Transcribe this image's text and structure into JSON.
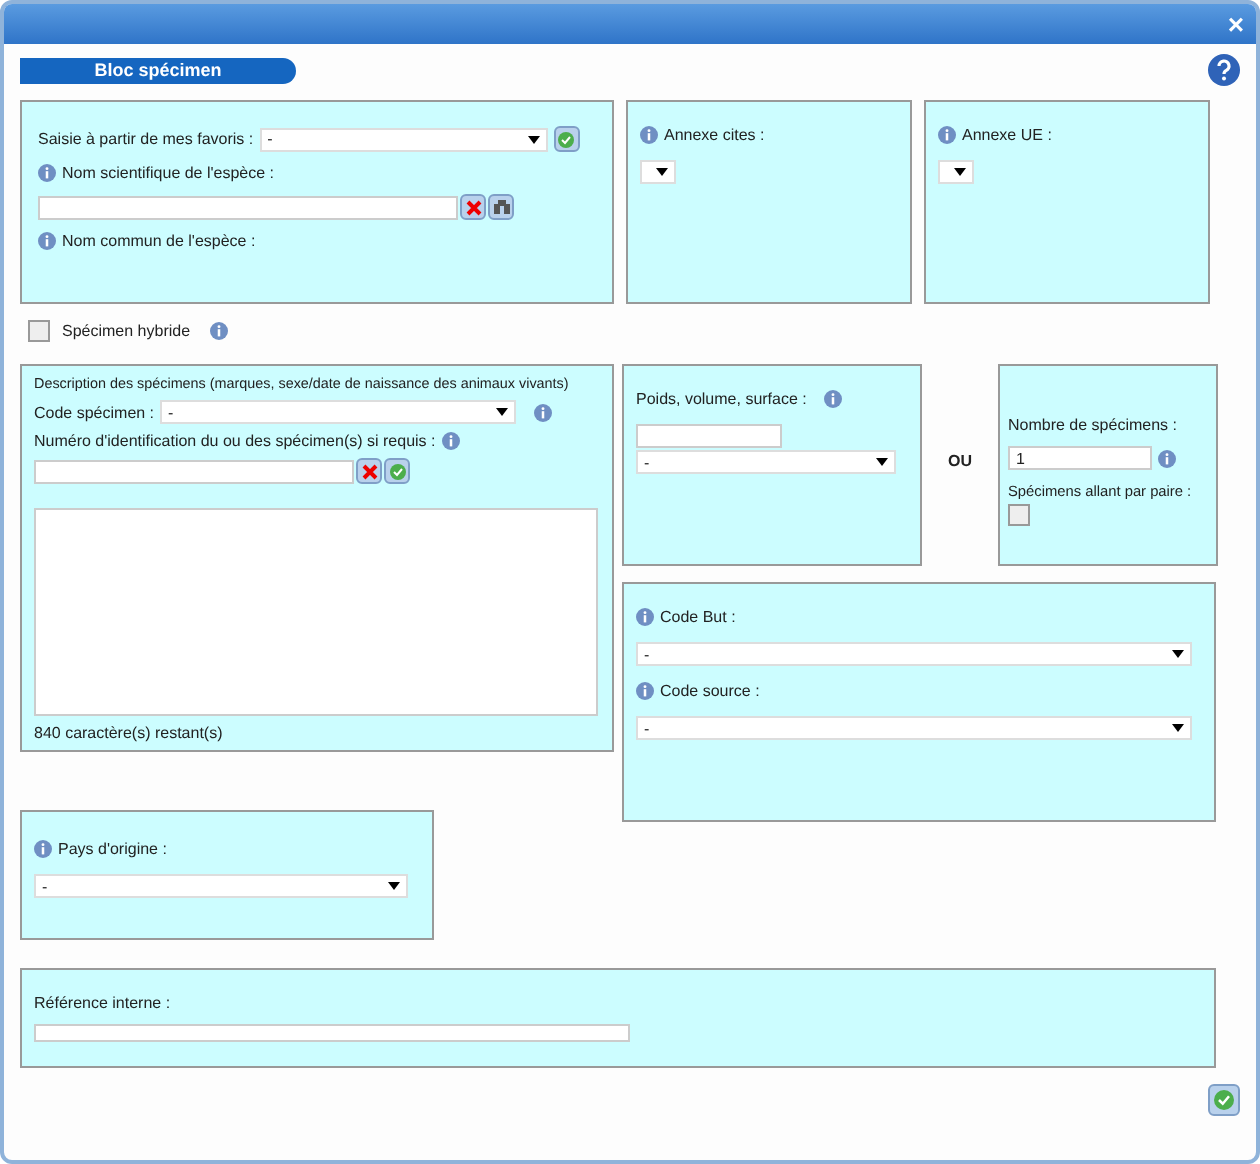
{
  "window": {
    "close": "×"
  },
  "section_title": "Bloc spécimen",
  "species": {
    "favorites_label": "Saisie à partir de mes favoris :",
    "favorites_value": "-",
    "scientific_label": "Nom scientifique de l'espèce :",
    "common_label": "Nom commun de l'espèce :"
  },
  "annexe_cites": {
    "label": "Annexe cites :"
  },
  "annexe_ue": {
    "label": "Annexe UE :"
  },
  "hybrid": {
    "label": "Spécimen hybride",
    "checked": false
  },
  "description": {
    "title": "Description des spécimens (marques, sexe/date de naissance des animaux vivants)",
    "code_label": "Code spécimen :",
    "code_value": "-",
    "id_label": "Numéro d'identification du ou des spécimen(s) si requis :",
    "remaining": "840 caractère(s) restant(s)"
  },
  "quantity": {
    "label": "Poids, volume, surface :",
    "unit_value": "-"
  },
  "or_label": "OU",
  "count": {
    "label": "Nombre de spécimens :",
    "value": "1",
    "pairs_label": "Spécimens allant par paire :",
    "pairs_checked": false
  },
  "codes": {
    "purpose_label": "Code But :",
    "purpose_value": "-",
    "source_label": "Code source :",
    "source_value": "-"
  },
  "origin": {
    "label": "Pays d'origine :",
    "value": "-"
  },
  "reference": {
    "label": "Référence interne :"
  }
}
